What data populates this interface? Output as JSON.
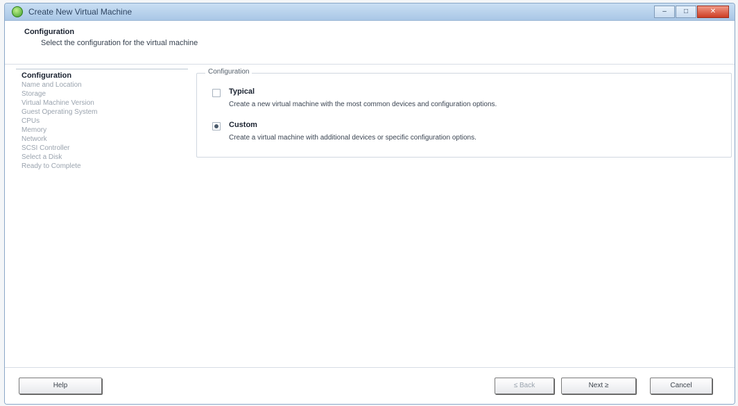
{
  "window": {
    "title": "Create New Virtual Machine",
    "controls": {
      "minimize": "–",
      "maximize": "□",
      "close": "✕"
    }
  },
  "header": {
    "title": "Configuration",
    "subtitle": "Select the configuration for the virtual machine"
  },
  "nav": {
    "items": [
      {
        "label": "Configuration",
        "active": true
      },
      {
        "label": "Name and Location"
      },
      {
        "label": "Storage"
      },
      {
        "label": "Virtual Machine Version"
      },
      {
        "label": "Guest Operating System"
      },
      {
        "label": "CPUs"
      },
      {
        "label": "Memory"
      },
      {
        "label": "Network"
      },
      {
        "label": "SCSI Controller"
      },
      {
        "label": "Select a Disk"
      },
      {
        "label": "Ready to Complete"
      }
    ]
  },
  "config": {
    "group_label": "Configuration",
    "options": [
      {
        "label": "Typical",
        "description": "Create a new virtual machine with the most common devices and configuration options.",
        "selected": false
      },
      {
        "label": "Custom",
        "description": "Create a virtual machine with additional devices or specific configuration options.",
        "selected": true
      }
    ]
  },
  "footer": {
    "help": "Help",
    "back": "≤ Back",
    "next": "Next ≥",
    "cancel": "Cancel"
  }
}
